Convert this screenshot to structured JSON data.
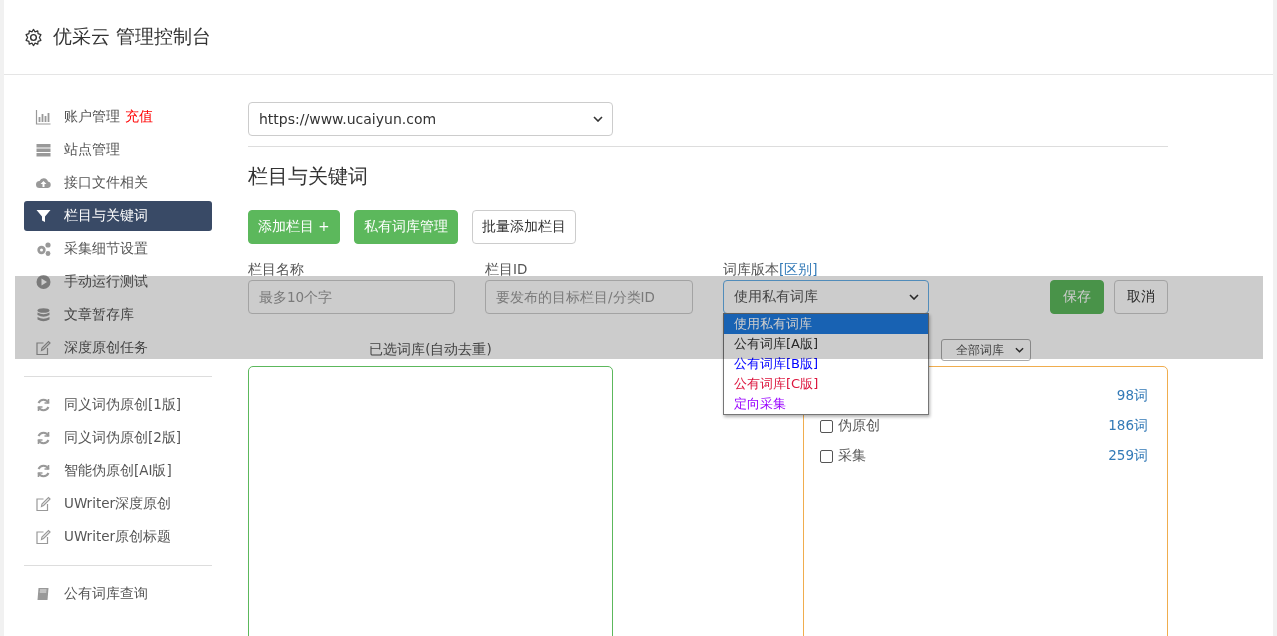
{
  "header": {
    "title": "优采云 管理控制台"
  },
  "sidebar": {
    "groups": [
      {
        "items": [
          {
            "label": "账户管理",
            "badge": "充值",
            "selected": false
          },
          {
            "label": "站点管理",
            "selected": false
          },
          {
            "label": "接口文件相关",
            "selected": false
          },
          {
            "label": "栏目与关键词",
            "selected": true
          },
          {
            "label": "采集细节设置",
            "selected": false
          },
          {
            "label": "手动运行测试",
            "selected": false
          },
          {
            "label": "文章暂存库",
            "selected": false
          },
          {
            "label": "深度原创任务",
            "selected": false
          }
        ]
      },
      {
        "items": [
          {
            "label": "同义词伪原创[1版]",
            "selected": false
          },
          {
            "label": "同义词伪原创[2版]",
            "selected": false
          },
          {
            "label": "智能伪原创[AI版]",
            "selected": false
          },
          {
            "label": "UWriter深度原创",
            "selected": false
          },
          {
            "label": "UWriter原创标题",
            "selected": false
          }
        ]
      },
      {
        "items": [
          {
            "label": "公有词库查询",
            "selected": false
          }
        ]
      }
    ]
  },
  "site_select": {
    "value": "https://www.ucaiyun.com"
  },
  "section_title": "栏目与关键词",
  "buttons": [
    {
      "label": "添加栏目 +",
      "kind": "primary"
    },
    {
      "label": "私有词库管理",
      "kind": "primary"
    },
    {
      "label": "批量添加栏目",
      "kind": "default"
    }
  ],
  "form": {
    "fields": [
      {
        "label": "栏目名称",
        "placeholder": "最多10个字"
      },
      {
        "label": "栏目ID",
        "placeholder": "要发布的目标栏目/分类ID"
      }
    ],
    "library": {
      "label": "词库版本",
      "link": "[区别]",
      "value": "使用私有词库",
      "expanded": true,
      "options": [
        {
          "label": "使用私有词库",
          "selected": true
        },
        {
          "label": "公有词库[A版]",
          "selected": false,
          "color": "#333333"
        },
        {
          "label": "公有词库[B版]",
          "selected": false,
          "color": "#0000ff"
        },
        {
          "label": "公有词库[C版]",
          "selected": false,
          "color": "#dc143c"
        },
        {
          "label": "定向采集",
          "selected": false,
          "color": "#9900ff"
        }
      ]
    },
    "save": "保存",
    "cancel": "取消"
  },
  "selected_panel": {
    "title": "已选词库(自动去重)"
  },
  "library_panel": {
    "filter": "全部词库",
    "items": [
      {
        "count": "98词"
      },
      {
        "label": "伪原创",
        "checked": false,
        "count": "186词"
      },
      {
        "label": "采集",
        "checked": false,
        "count": "259词"
      }
    ]
  }
}
